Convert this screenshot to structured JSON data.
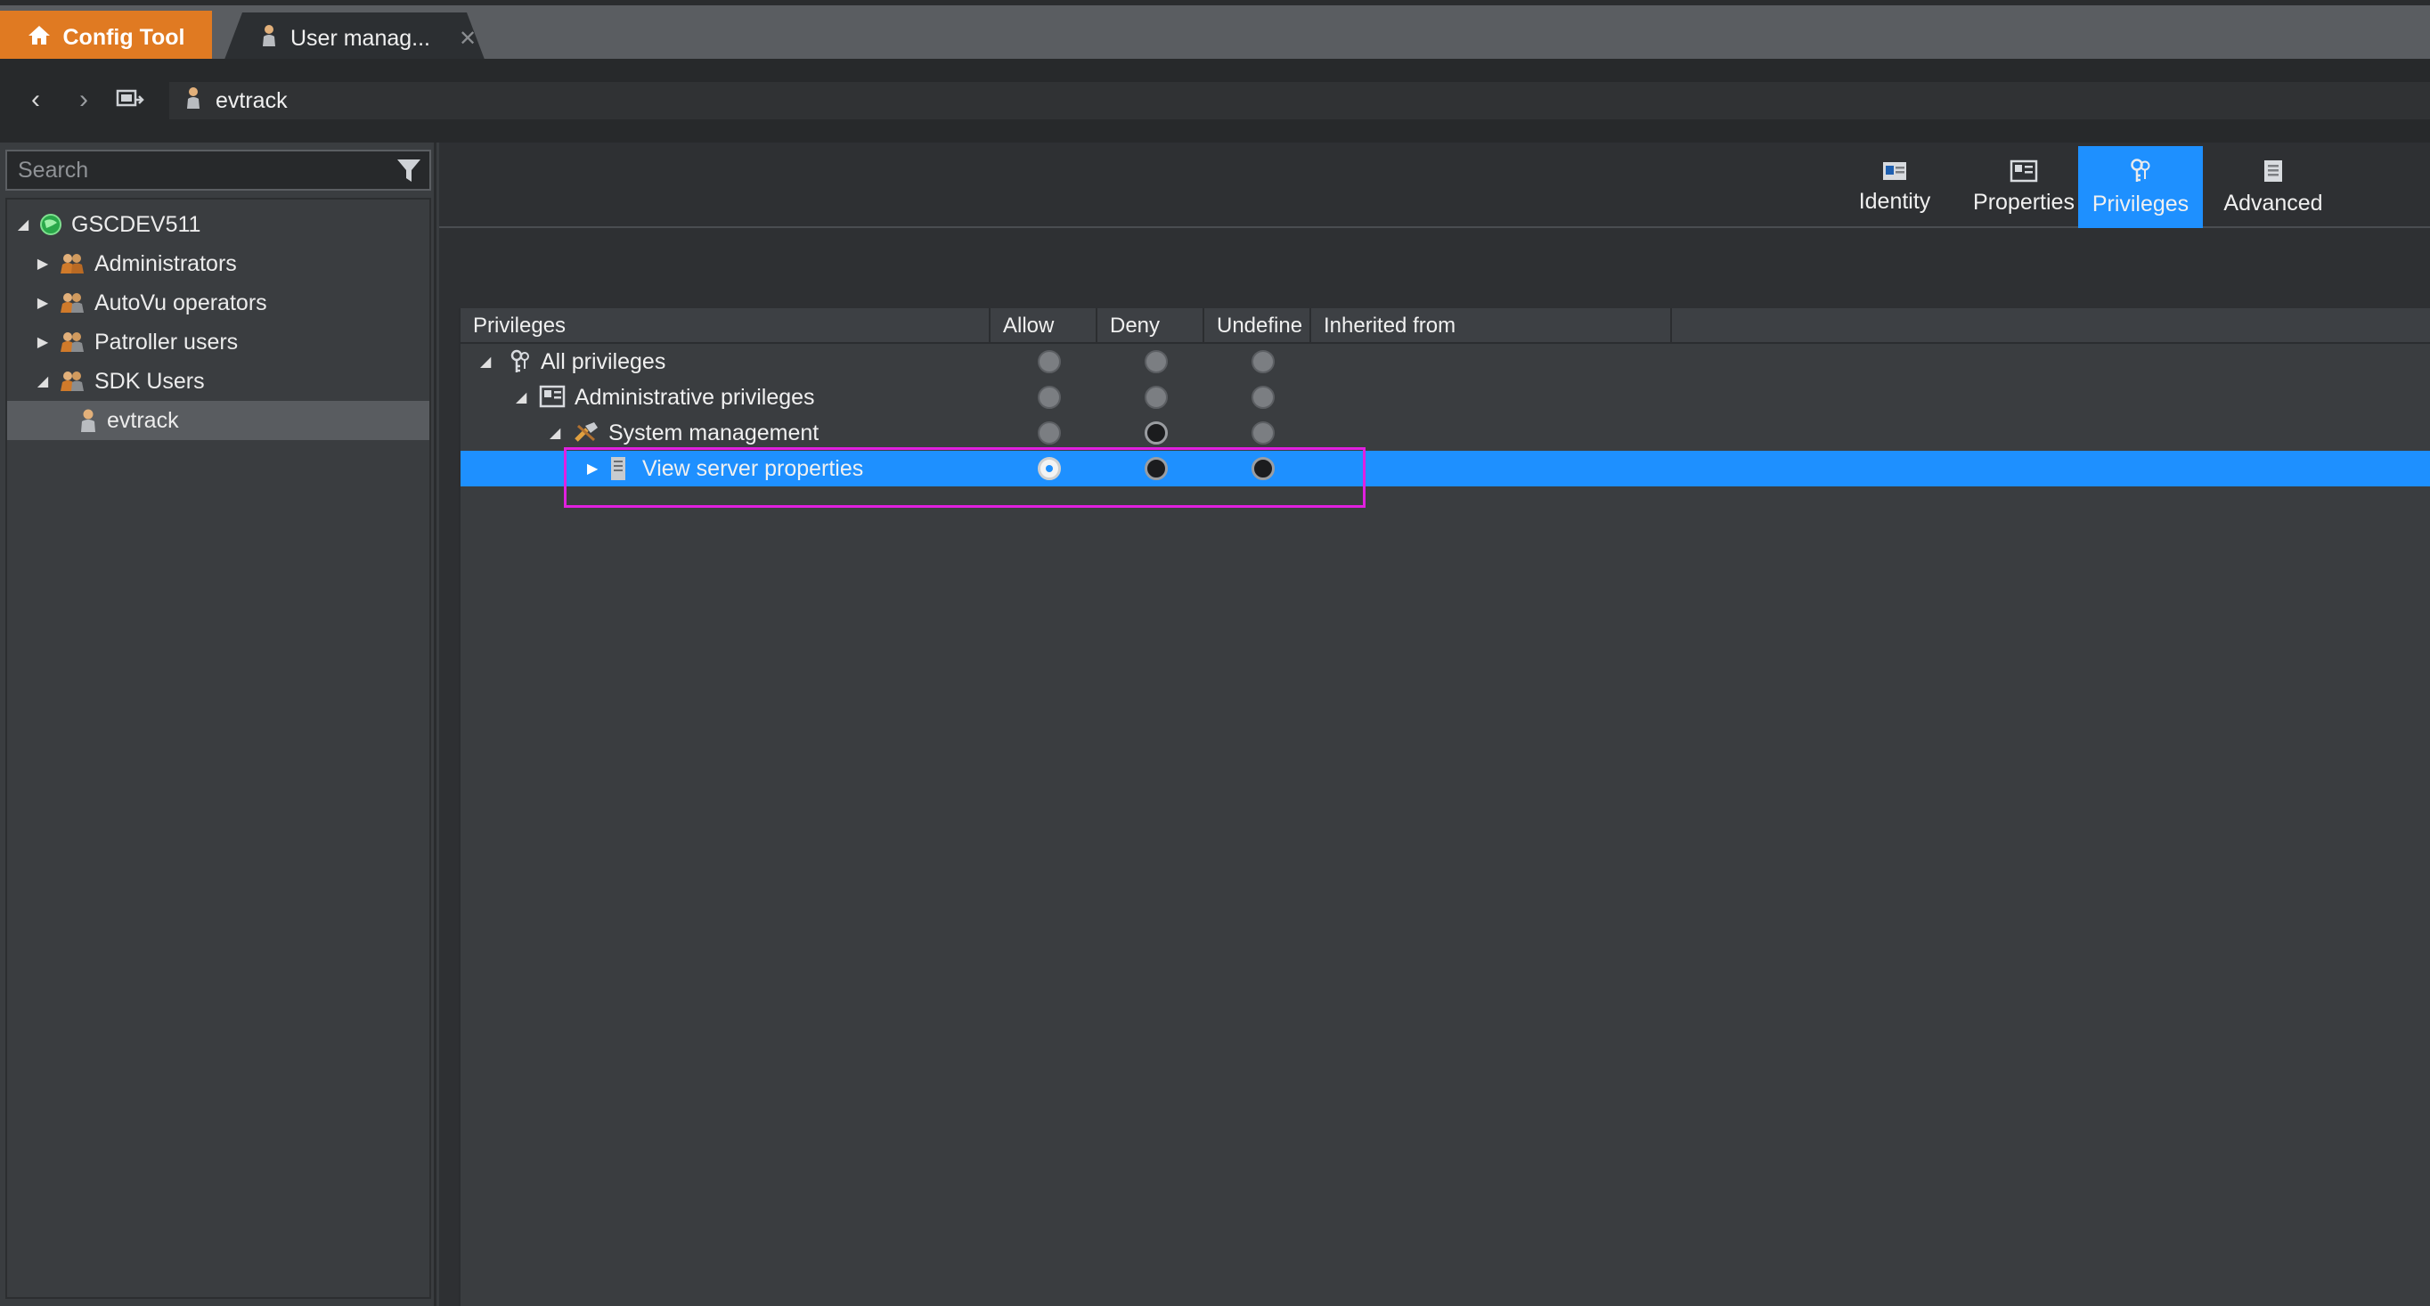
{
  "colors": {
    "accent": "#1e90ff",
    "home_tab": "#e07a22",
    "highlight": "#e020e0"
  },
  "tabs": {
    "home_label": "Config Tool",
    "doc_label": "User manag...",
    "close_glyph": "✕"
  },
  "nav": {
    "back_glyph": "‹",
    "forward_glyph": "›",
    "breadcrumb": "evtrack"
  },
  "search": {
    "placeholder": "Search"
  },
  "tree": {
    "root": "GSCDEV511",
    "items": [
      {
        "label": "Administrators"
      },
      {
        "label": "AutoVu operators"
      },
      {
        "label": "Patroller users"
      },
      {
        "label": "SDK Users"
      },
      {
        "label": "evtrack",
        "selected": true
      }
    ]
  },
  "page_tabs": [
    {
      "label": "Identity",
      "icon": "identity-icon"
    },
    {
      "label": "Properties",
      "icon": "properties-icon"
    },
    {
      "label": "Privileges",
      "icon": "privileges-icon",
      "active": true
    },
    {
      "label": "Advanced",
      "icon": "advanced-icon"
    }
  ],
  "grid": {
    "headers": [
      "Privileges",
      "Allow",
      "Deny",
      "Undefine",
      "Inherited from"
    ],
    "rows": [
      {
        "label": "All privileges",
        "allow": "unset",
        "deny": "unset",
        "undefine": "unset"
      },
      {
        "label": "Administrative privileges",
        "allow": "unset",
        "deny": "unset",
        "undefine": "unset"
      },
      {
        "label": "System management",
        "allow": "unset",
        "deny": "partial",
        "undefine": "unset"
      },
      {
        "label": "View server properties",
        "allow": "checked",
        "deny": "partial",
        "undefine": "partial",
        "selected": true
      }
    ]
  }
}
